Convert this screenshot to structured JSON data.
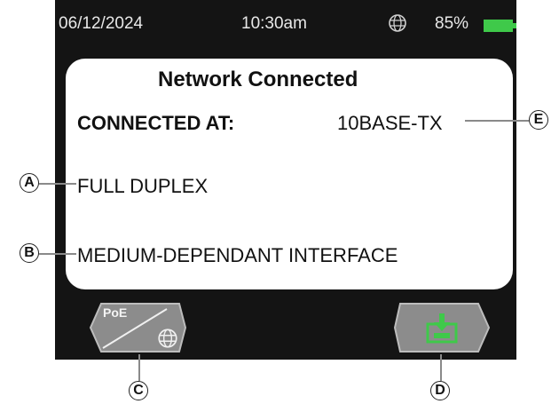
{
  "status_bar": {
    "date": "06/12/2024",
    "time": "10:30am",
    "network_icon": "globe-icon",
    "battery_percent": "85%",
    "battery_level": 0.85,
    "battery_color": "#3fc94a"
  },
  "panel": {
    "title": "Network Connected",
    "connected_at_label": "CONNECTED AT:",
    "connected_at_value": "10BASE-TX",
    "duplex": "FULL DUPLEX",
    "interface": "MEDIUM-DEPENDANT INTERFACE"
  },
  "softkeys": {
    "poe_label": "PoE",
    "poe_icon": "globe-icon",
    "save_icon": "download-icon",
    "save_color": "#3fc94a"
  },
  "callouts": {
    "a": "A",
    "b": "B",
    "c": "C",
    "d": "D",
    "e": "E"
  }
}
